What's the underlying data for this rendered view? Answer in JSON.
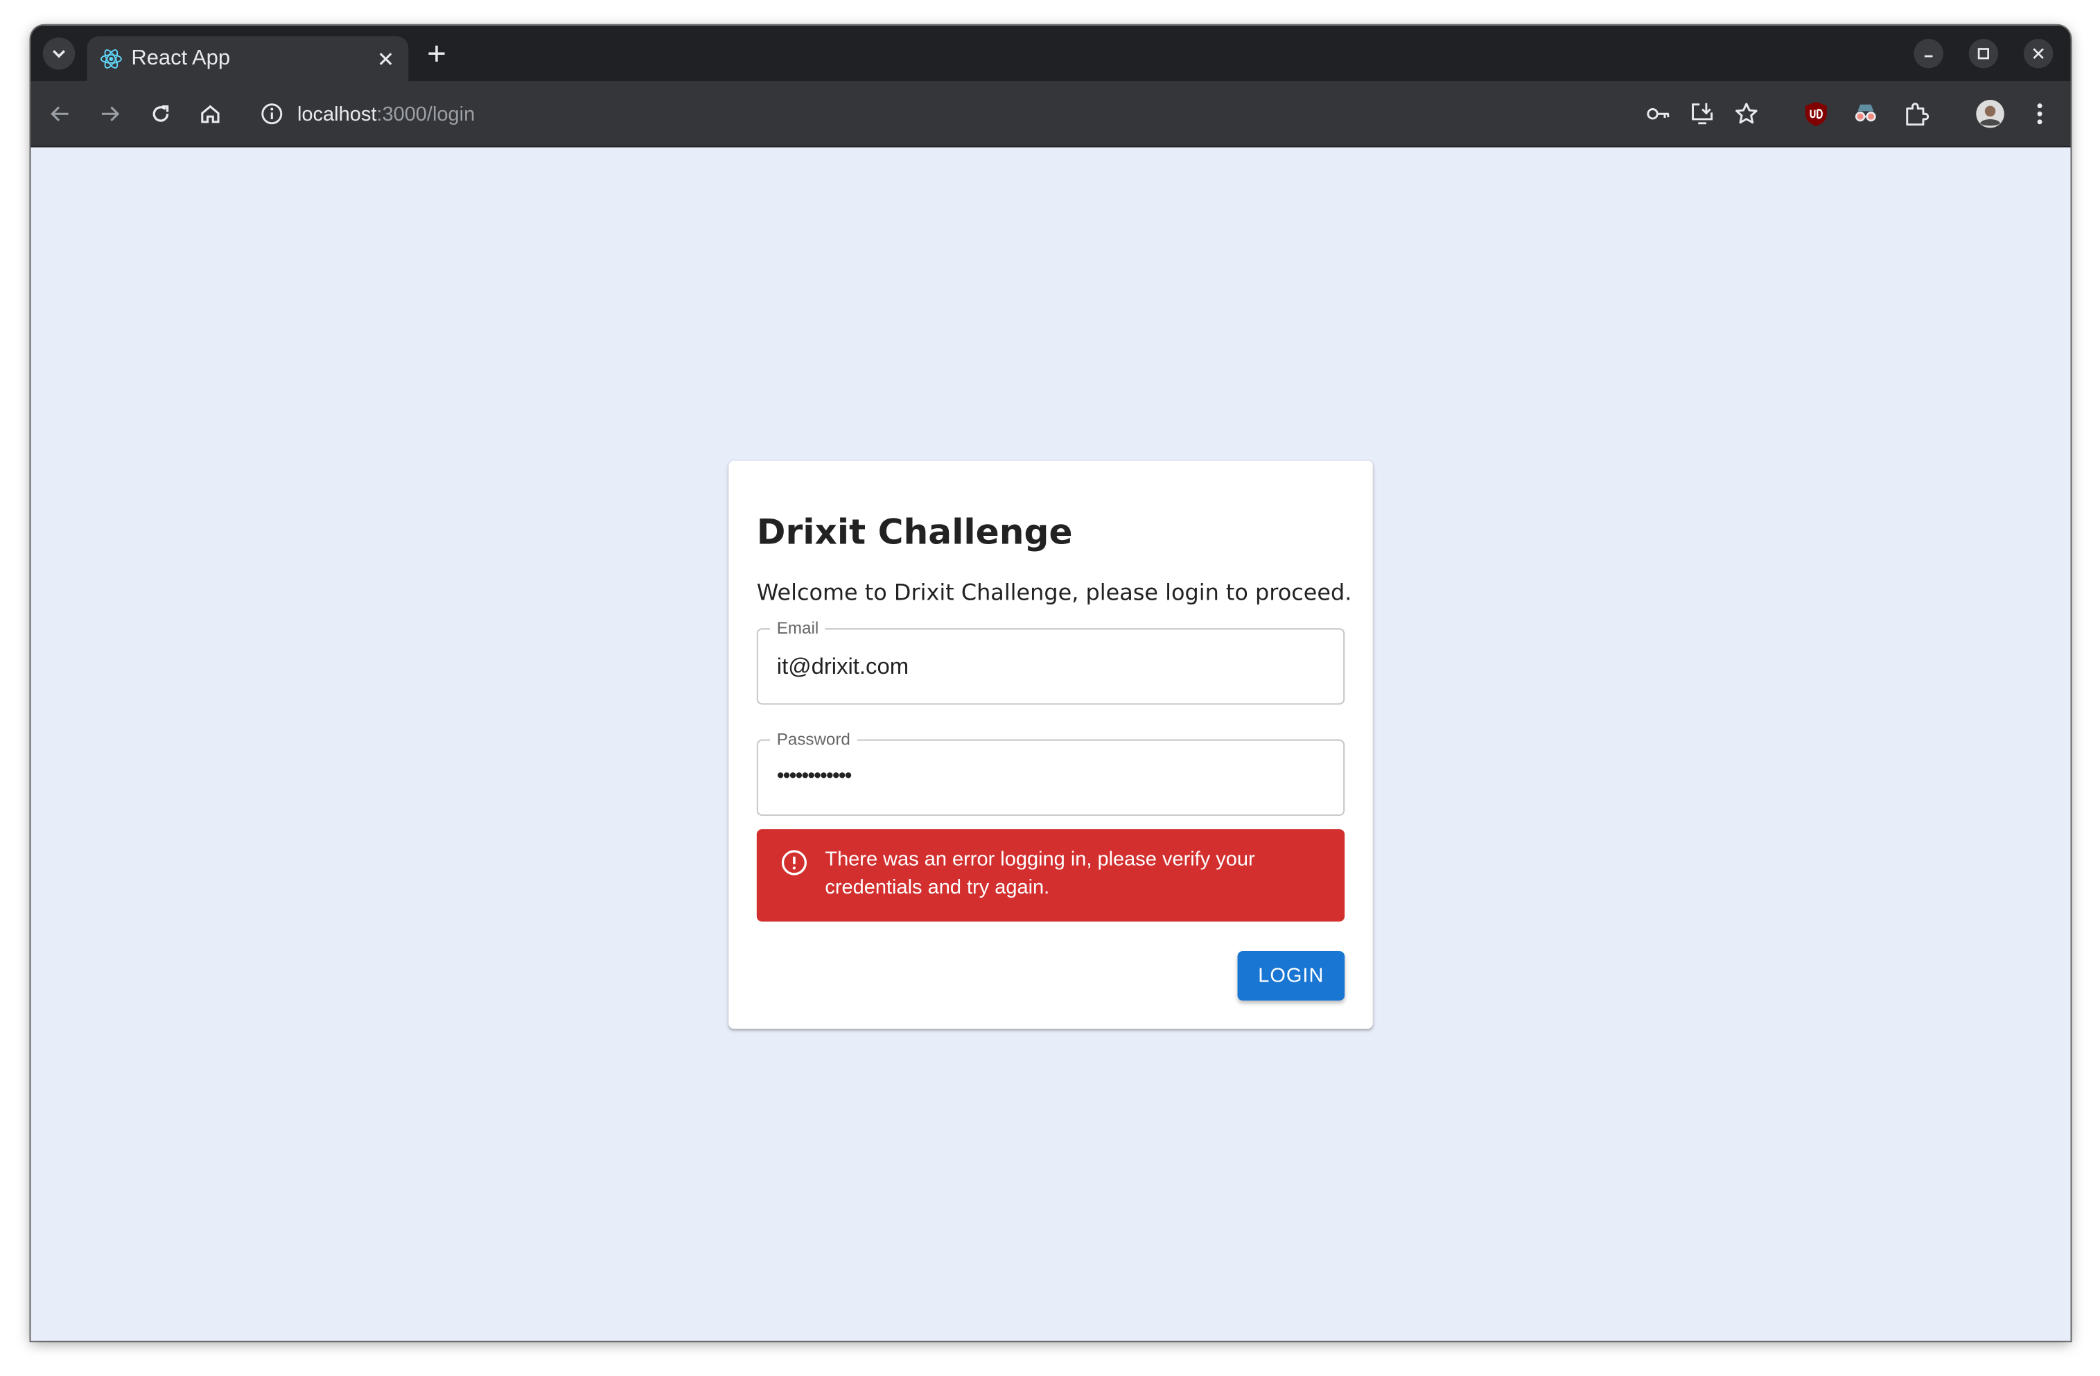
{
  "browser": {
    "tab": {
      "title": "React App",
      "favicon": "react-icon"
    },
    "address_bar": {
      "host": "localhost",
      "path": ":3000/login"
    },
    "icons": [
      "tab-search-icon",
      "close-icon",
      "plus-icon",
      "minimize-icon",
      "maximize-icon",
      "back-icon",
      "forward-icon",
      "reload-icon",
      "home-icon",
      "site-info-icon",
      "password-key-icon",
      "install-app-icon",
      "bookmark-star-icon",
      "ublock-icon",
      "spy-extension-icon",
      "extensions-puzzle-icon",
      "profile-avatar-icon",
      "more-menu-icon"
    ]
  },
  "login_card": {
    "title": "Drixit Challenge",
    "subtitle": "Welcome to Drixit Challenge, please login to proceed.",
    "email": {
      "label": "Email",
      "value": "it@drixit.com"
    },
    "password": {
      "label": "Password",
      "masked_value": "••••••••••••"
    },
    "error_alert": {
      "icon": "error-outline-icon",
      "message": "There was an error logging in, please verify your credentials and try again."
    },
    "login_button": "LOGIN"
  },
  "colors": {
    "page_background": "#e7edf9",
    "error": "#d32f2f",
    "primary": "#1976d2",
    "browser_chrome": "#202124"
  }
}
